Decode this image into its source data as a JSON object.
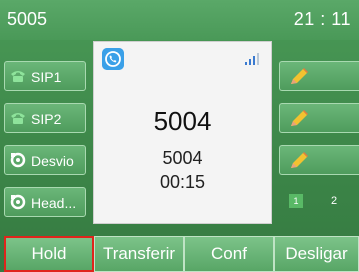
{
  "status": {
    "title": "5005",
    "clock": "21 : 11"
  },
  "line_keys": [
    {
      "label": "SIP1",
      "icon": "phone-icon"
    },
    {
      "label": "SIP2",
      "icon": "phone-icon"
    },
    {
      "label": "Desvio",
      "icon": "forward-icon"
    },
    {
      "label": "Head...",
      "icon": "headset-icon"
    }
  ],
  "call": {
    "name": "5004",
    "number": "5004",
    "duration": "00:15"
  },
  "pages": {
    "current": "1",
    "next": "2"
  },
  "softkeys": [
    {
      "label": "Hold",
      "selected": true
    },
    {
      "label": "Transferir",
      "selected": false
    },
    {
      "label": "Conf",
      "selected": false
    },
    {
      "label": "Desligar",
      "selected": false
    }
  ],
  "colors": {
    "accent": "#4a9a57",
    "call_badge": "#3aa0e8",
    "selected_border": "#e0241b"
  }
}
